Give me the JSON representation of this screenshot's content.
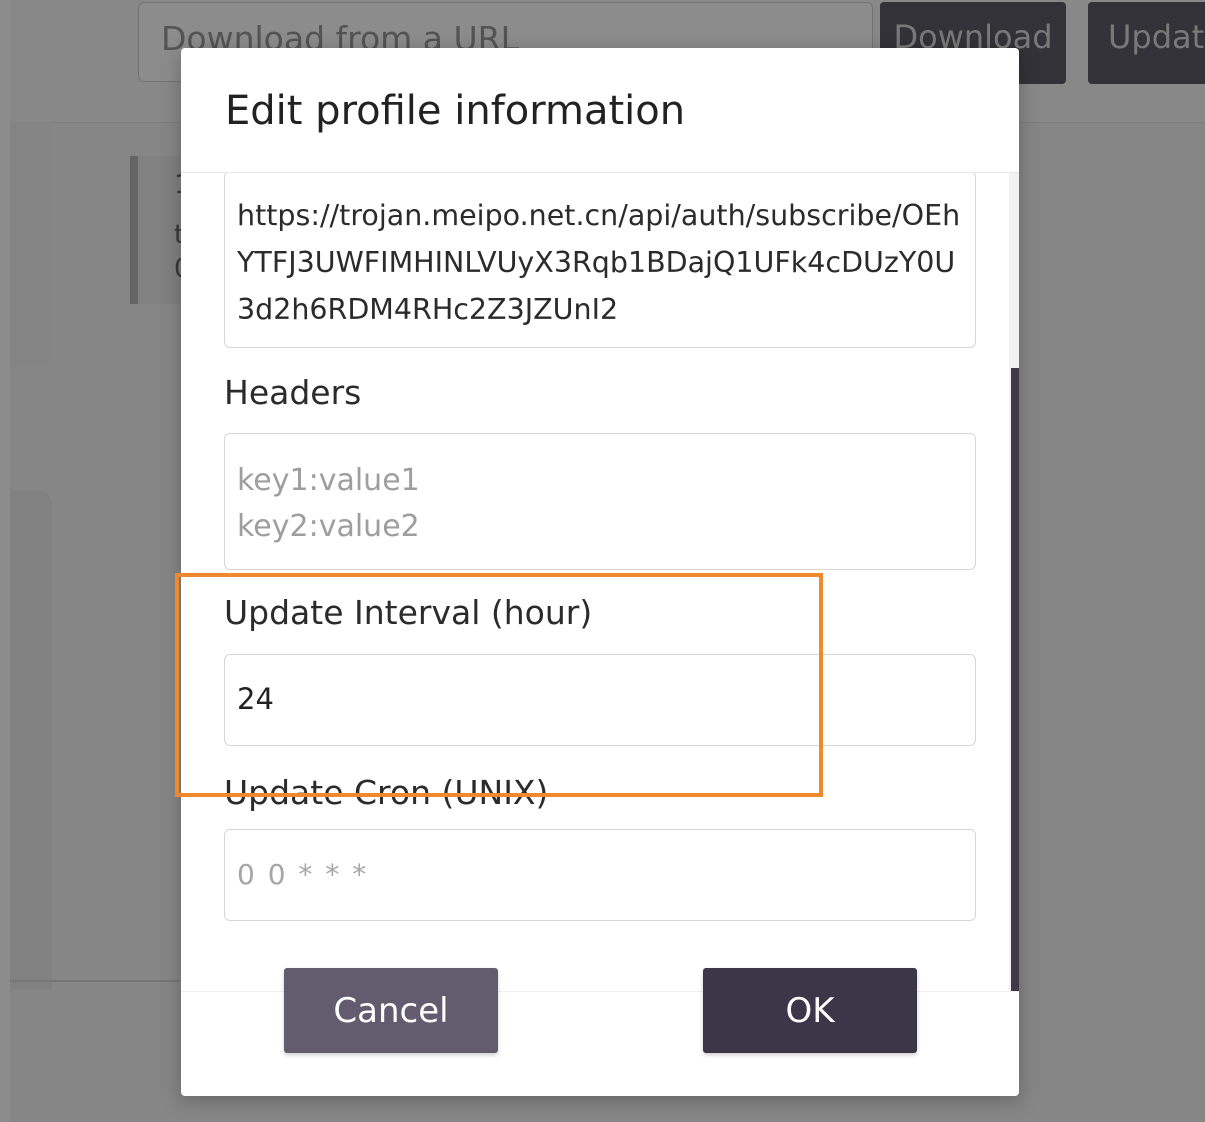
{
  "background": {
    "url_placeholder": "Download from a URL",
    "copy_icon": "copy-icon",
    "download_label": "Download",
    "update_label": "Update",
    "card_lines": [
      "1",
      "t",
      "0"
    ]
  },
  "dialog": {
    "title": "Edit profile information",
    "url_value": "https://trojan.meipo.net.cn/api/auth/subscribe/OEhYTFJ3UWFIMHINLVUyX3Rqb1BDajQ1UFk4cDUzY0U3d2h6RDM4RHc2Z3JZUnI2",
    "headers_label": "Headers",
    "headers_placeholder_line1": "key1:value1",
    "headers_placeholder_line2": "key2:value2",
    "interval_label": "Update Interval (hour)",
    "interval_value": "24",
    "cron_label": "Update Cron (UNIX)",
    "cron_placeholder": "0 0 * * *",
    "cancel_label": "Cancel",
    "ok_label": "OK"
  },
  "colors": {
    "highlight": "#f0882e",
    "ok_button": "#3b3648",
    "cancel_button": "#625c6e"
  }
}
